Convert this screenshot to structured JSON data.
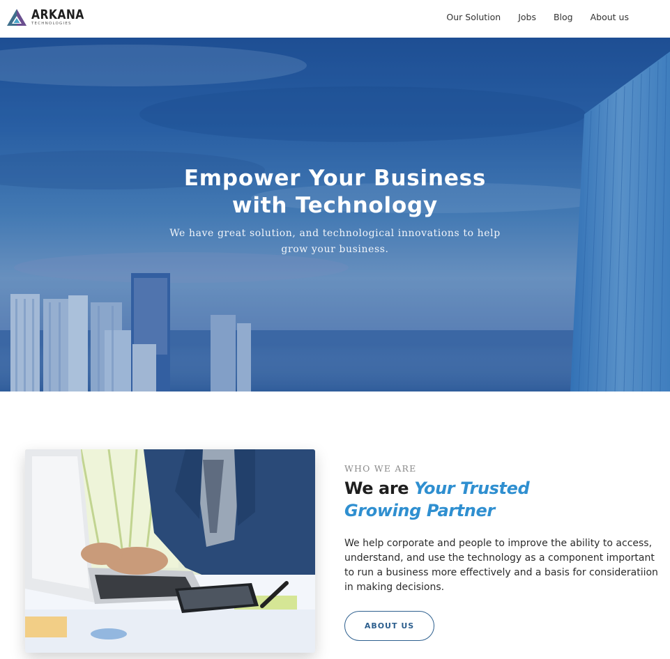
{
  "header": {
    "logo": {
      "name": "ARKANA",
      "sub": "TECHNOLOGIES"
    },
    "nav": [
      {
        "label": "Our Solution"
      },
      {
        "label": "Jobs"
      },
      {
        "label": "Blog"
      },
      {
        "label": "About us"
      }
    ]
  },
  "hero": {
    "title_line1": "Empower Your Business",
    "title_line2": "with Technology",
    "subtitle_line1": "We have great solution, and technological innovations to help",
    "subtitle_line2": "grow your business."
  },
  "about": {
    "eyebrow": "WHO WE ARE",
    "heading_plain": "We are ",
    "heading_accent_1": "Your Trusted",
    "heading_accent_2": "Growing Partner",
    "body": "We help corporate and people to improve the ability to access, understand, and use the technology as a component important to run a business more effectively and a basis for consideratiion in making decisions.",
    "button_label": "ABOUT US"
  },
  "colors": {
    "accent": "#2f8fd0",
    "button": "#2d5f8e"
  },
  "icons": {
    "logo": "triangle-logo-icon"
  }
}
